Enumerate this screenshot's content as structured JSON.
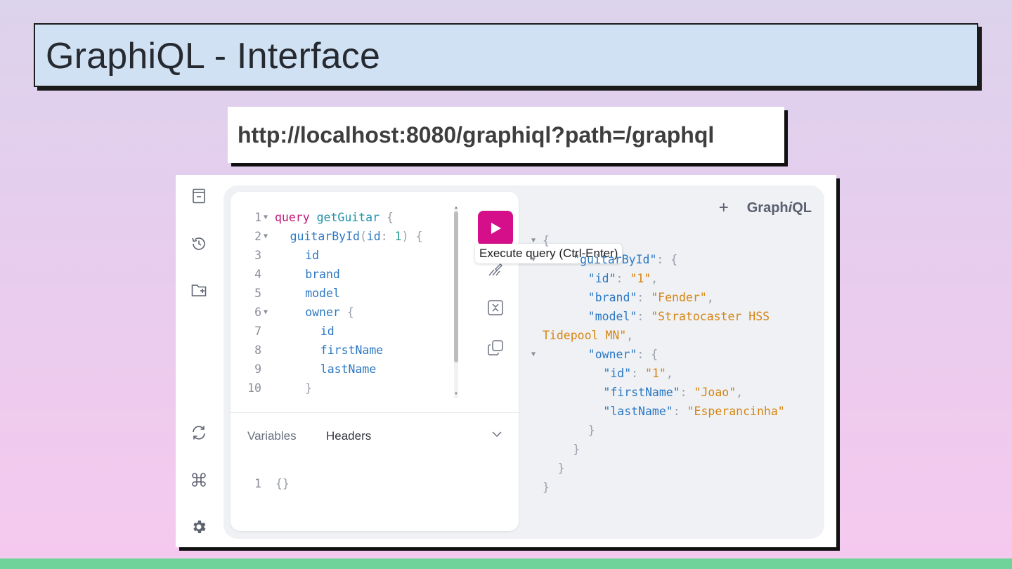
{
  "slide": {
    "title": "GraphiQL - Interface",
    "url": "http://localhost:8080/graphiql?path=/graphql"
  },
  "graphiql": {
    "logo_pre": "Graph",
    "logo_i": "i",
    "logo_post": "QL",
    "add_tab_label": "+",
    "tooltip": "Execute query (Ctrl-Enter)",
    "bottom_tabs": {
      "variables": "Variables",
      "headers": "Headers"
    },
    "variables_editor": {
      "line_number": "1",
      "content": "{}"
    },
    "query_lines": [
      {
        "n": "1",
        "fold": true,
        "indent": 0,
        "parts": [
          [
            "kw",
            "query"
          ],
          [
            "sp",
            " "
          ],
          [
            "fn",
            "getGuitar"
          ],
          [
            "sp",
            " "
          ],
          [
            "pun",
            "{"
          ]
        ]
      },
      {
        "n": "2",
        "fold": true,
        "indent": 1,
        "parts": [
          [
            "fld",
            "guitarById"
          ],
          [
            "pun",
            "("
          ],
          [
            "fld",
            "id"
          ],
          [
            "pun",
            ": "
          ],
          [
            "num",
            "1"
          ],
          [
            "pun",
            ")"
          ],
          [
            "sp",
            " "
          ],
          [
            "pun",
            "{"
          ]
        ]
      },
      {
        "n": "3",
        "fold": false,
        "indent": 2,
        "parts": [
          [
            "fld",
            "id"
          ]
        ]
      },
      {
        "n": "4",
        "fold": false,
        "indent": 2,
        "parts": [
          [
            "fld",
            "brand"
          ]
        ]
      },
      {
        "n": "5",
        "fold": false,
        "indent": 2,
        "parts": [
          [
            "fld",
            "model"
          ]
        ]
      },
      {
        "n": "6",
        "fold": true,
        "indent": 2,
        "parts": [
          [
            "fld",
            "owner"
          ],
          [
            "sp",
            " "
          ],
          [
            "pun",
            "{"
          ]
        ]
      },
      {
        "n": "7",
        "fold": false,
        "indent": 3,
        "parts": [
          [
            "fld",
            "id"
          ]
        ]
      },
      {
        "n": "8",
        "fold": false,
        "indent": 3,
        "parts": [
          [
            "fld",
            "firstName"
          ]
        ]
      },
      {
        "n": "9",
        "fold": false,
        "indent": 3,
        "parts": [
          [
            "fld",
            "lastName"
          ]
        ]
      },
      {
        "n": "10",
        "fold": false,
        "indent": 2,
        "parts": [
          [
            "pun",
            "}"
          ]
        ]
      }
    ],
    "result_lines": [
      {
        "fold": true,
        "indent": 0,
        "parts": [
          [
            "pun",
            "{"
          ]
        ]
      },
      {
        "fold": true,
        "indent": 2,
        "parts": [
          [
            "fld",
            "\"guitarById\""
          ],
          [
            "pun",
            ": {"
          ]
        ]
      },
      {
        "fold": false,
        "indent": 3,
        "parts": [
          [
            "fld",
            "\"id\""
          ],
          [
            "pun",
            ": "
          ],
          [
            "str",
            "\"1\""
          ],
          [
            "pun",
            ","
          ]
        ]
      },
      {
        "fold": false,
        "indent": 3,
        "parts": [
          [
            "fld",
            "\"brand\""
          ],
          [
            "pun",
            ": "
          ],
          [
            "str",
            "\"Fender\""
          ],
          [
            "pun",
            ","
          ]
        ]
      },
      {
        "fold": false,
        "indent": 3,
        "parts": [
          [
            "fld",
            "\"model\""
          ],
          [
            "pun",
            ": "
          ],
          [
            "str",
            "\"Stratocaster HSS"
          ]
        ]
      },
      {
        "fold": false,
        "indent": 0,
        "parts": [
          [
            "str",
            "Tidepool MN\""
          ],
          [
            "pun",
            ","
          ]
        ]
      },
      {
        "fold": true,
        "indent": 3,
        "parts": [
          [
            "fld",
            "\"owner\""
          ],
          [
            "pun",
            ": {"
          ]
        ]
      },
      {
        "fold": false,
        "indent": 4,
        "parts": [
          [
            "fld",
            "\"id\""
          ],
          [
            "pun",
            ": "
          ],
          [
            "str",
            "\"1\""
          ],
          [
            "pun",
            ","
          ]
        ]
      },
      {
        "fold": false,
        "indent": 4,
        "parts": [
          [
            "fld",
            "\"firstName\""
          ],
          [
            "pun",
            ": "
          ],
          [
            "str",
            "\"Joao\""
          ],
          [
            "pun",
            ","
          ]
        ]
      },
      {
        "fold": false,
        "indent": 4,
        "parts": [
          [
            "fld",
            "\"lastName\""
          ],
          [
            "pun",
            ": "
          ],
          [
            "str",
            "\"Esperancinha\""
          ]
        ]
      },
      {
        "fold": false,
        "indent": 3,
        "parts": [
          [
            "pun",
            "}"
          ]
        ]
      },
      {
        "fold": false,
        "indent": 2,
        "parts": [
          [
            "pun",
            "}"
          ]
        ]
      },
      {
        "fold": false,
        "indent": 1,
        "parts": [
          [
            "pun",
            "}"
          ]
        ]
      },
      {
        "fold": false,
        "indent": 0,
        "parts": [
          [
            "pun",
            "}"
          ]
        ]
      }
    ],
    "sidebar_icons": [
      "docs-icon",
      "history-icon",
      "explorer-icon",
      "refetch-schema-icon",
      "shortcuts-icon",
      "settings-icon"
    ],
    "toolbar_icons": [
      "execute-icon",
      "prettify-icon",
      "merge-fragments-icon",
      "copy-query-icon"
    ],
    "colors": {
      "run_button": "#d50e89",
      "keyword": "#c4177a",
      "field": "#2b78c4",
      "string": "#d58512",
      "number": "#2a9d8f"
    }
  }
}
